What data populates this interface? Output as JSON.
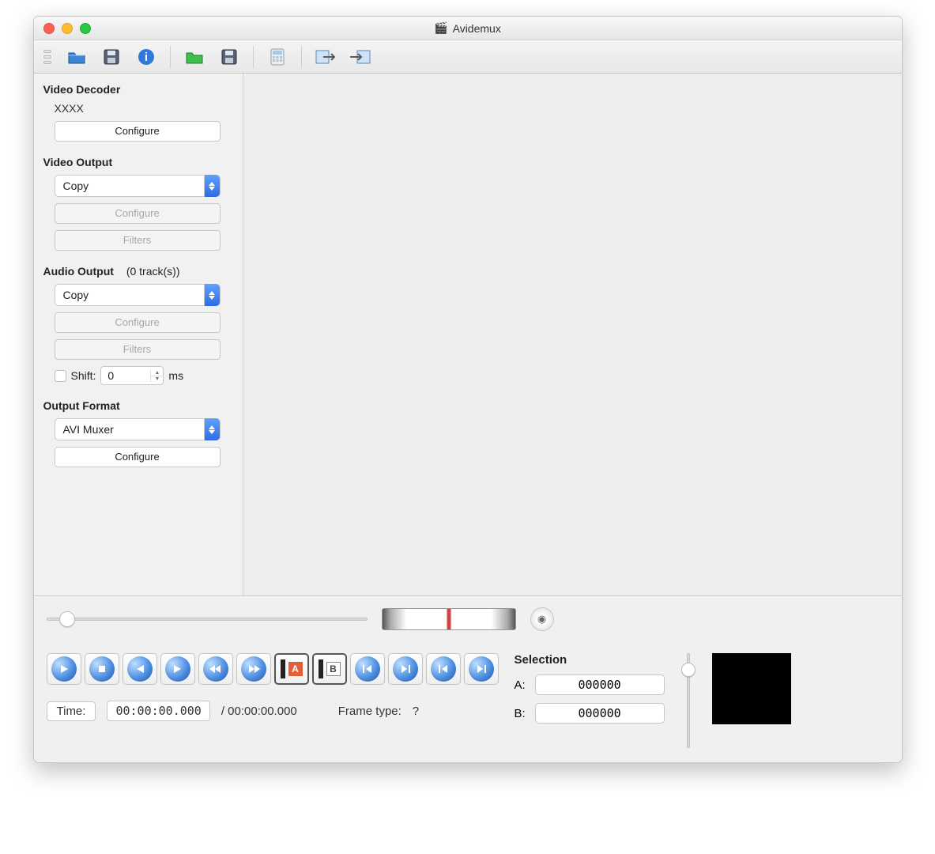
{
  "window": {
    "title": "Avidemux"
  },
  "sidebar": {
    "video_decoder": {
      "label": "Video Decoder",
      "value": "XXXX",
      "configure": "Configure"
    },
    "video_output": {
      "label": "Video Output",
      "selected": "Copy",
      "configure": "Configure",
      "filters": "Filters"
    },
    "audio_output": {
      "label": "Audio Output",
      "tracks_suffix": "(0 track(s))",
      "selected": "Copy",
      "configure": "Configure",
      "filters": "Filters",
      "shift_label": "Shift:",
      "shift_value": "0",
      "shift_unit": "ms"
    },
    "output_format": {
      "label": "Output Format",
      "selected": "AVI Muxer",
      "configure": "Configure"
    }
  },
  "bottom": {
    "time_label": "Time:",
    "time_current": "00:00:00.000",
    "time_total_prefix": "/ ",
    "time_total": "00:00:00.000",
    "frame_type_label": "Frame type:",
    "frame_type_value": "?",
    "selection": {
      "label": "Selection",
      "a_label": "A:",
      "a_value": "000000",
      "b_label": "B:",
      "b_value": "000000"
    }
  }
}
